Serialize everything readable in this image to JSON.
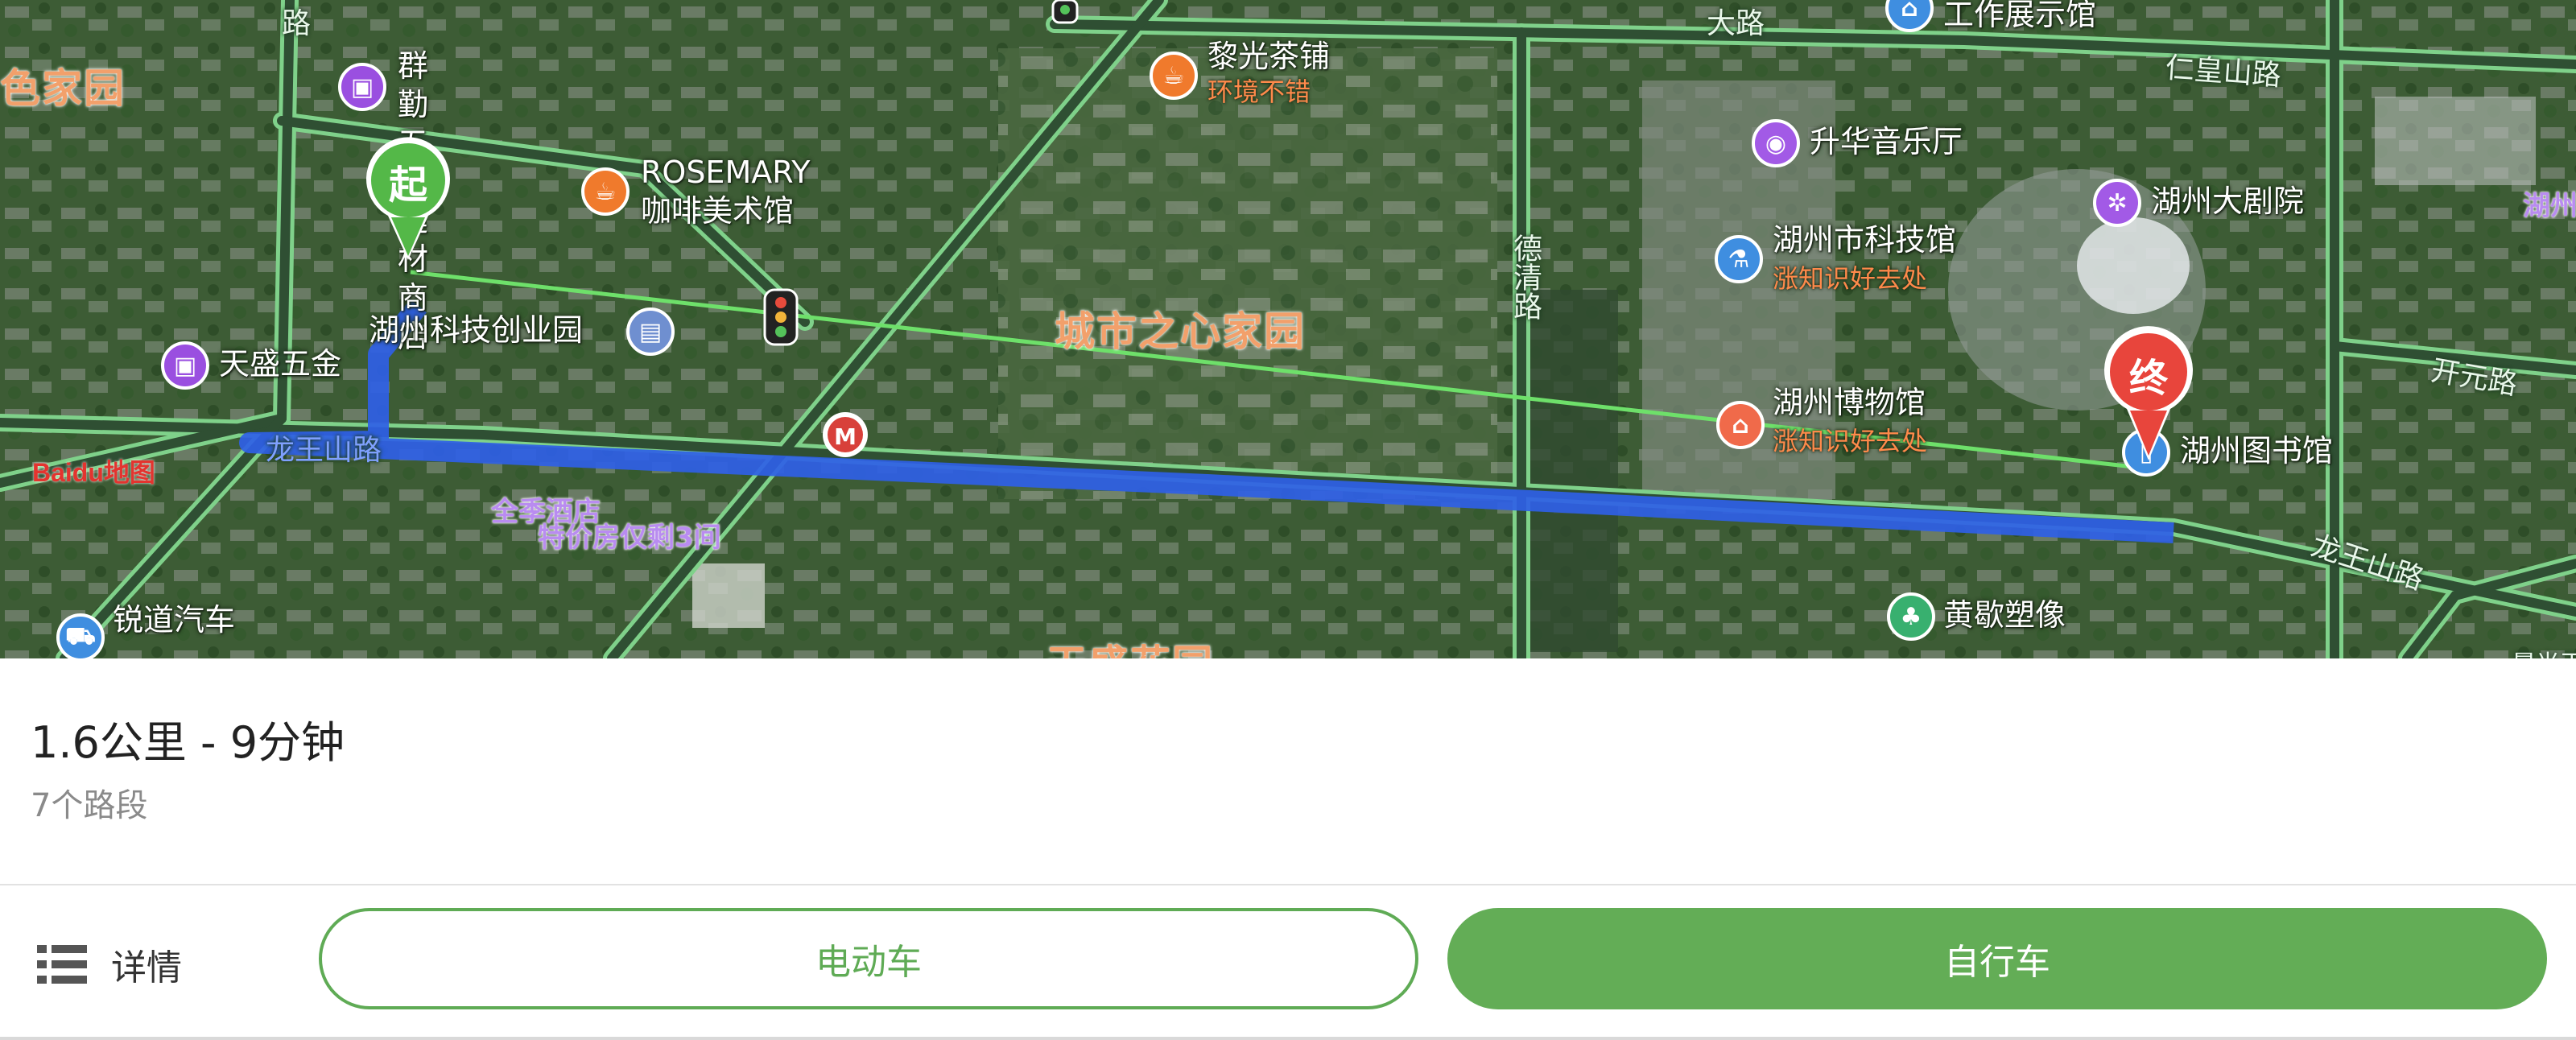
{
  "map": {
    "area_labels": {
      "left_estate": "色家园",
      "city_heart": "城市之心家园",
      "bottom_estate": "天盛花园"
    },
    "road_labels": {
      "renhuangshan": "仁皇山路",
      "deqing": "德清路",
      "kaiyuan": "开元路",
      "longwangshan_east": "龙王山路",
      "longwangshan_west": "龙王山路",
      "top_road": "路",
      "top_left_road": "路",
      "top_center_road": "大路"
    },
    "pois": {
      "qunqin": "群勤五金\n建材商店",
      "rosemary": "ROSEMARY\n咖啡美术馆",
      "liguang": "黎光茶铺",
      "liguang_sub": "环境不错",
      "science_park": "湖州科技创业园",
      "tiansheng": "天盛五金",
      "quanji": "全季酒店",
      "quanji_sub": "特价房仅剩3间",
      "ruidao": "锐道汽车",
      "work_exhibit": "工作展示馆",
      "shenghua": "升华音乐厅",
      "science_museum": "湖州市科技馆",
      "science_museum_sub": "涨知识好去处",
      "museum": "湖州博物馆",
      "museum_sub": "涨知识好去处",
      "theater": "湖州大剧院",
      "library": "湖州图书馆",
      "huangxie": "黄歇塑像",
      "edge_right": "湖州",
      "edge_bottom_right": "晨光天地"
    },
    "start_marker": "起",
    "end_marker": "终",
    "logo": "Baidu地图"
  },
  "route": {
    "summary": "1.6公里 - 9分钟",
    "segments": "7个路段"
  },
  "actions": {
    "details": "详情",
    "ebike": "电动车",
    "bicycle": "自行车"
  },
  "colors": {
    "route": "#2f5fe6",
    "accent_green": "#63ad56",
    "end_marker": "#e8453c",
    "start_marker": "#54b848"
  }
}
